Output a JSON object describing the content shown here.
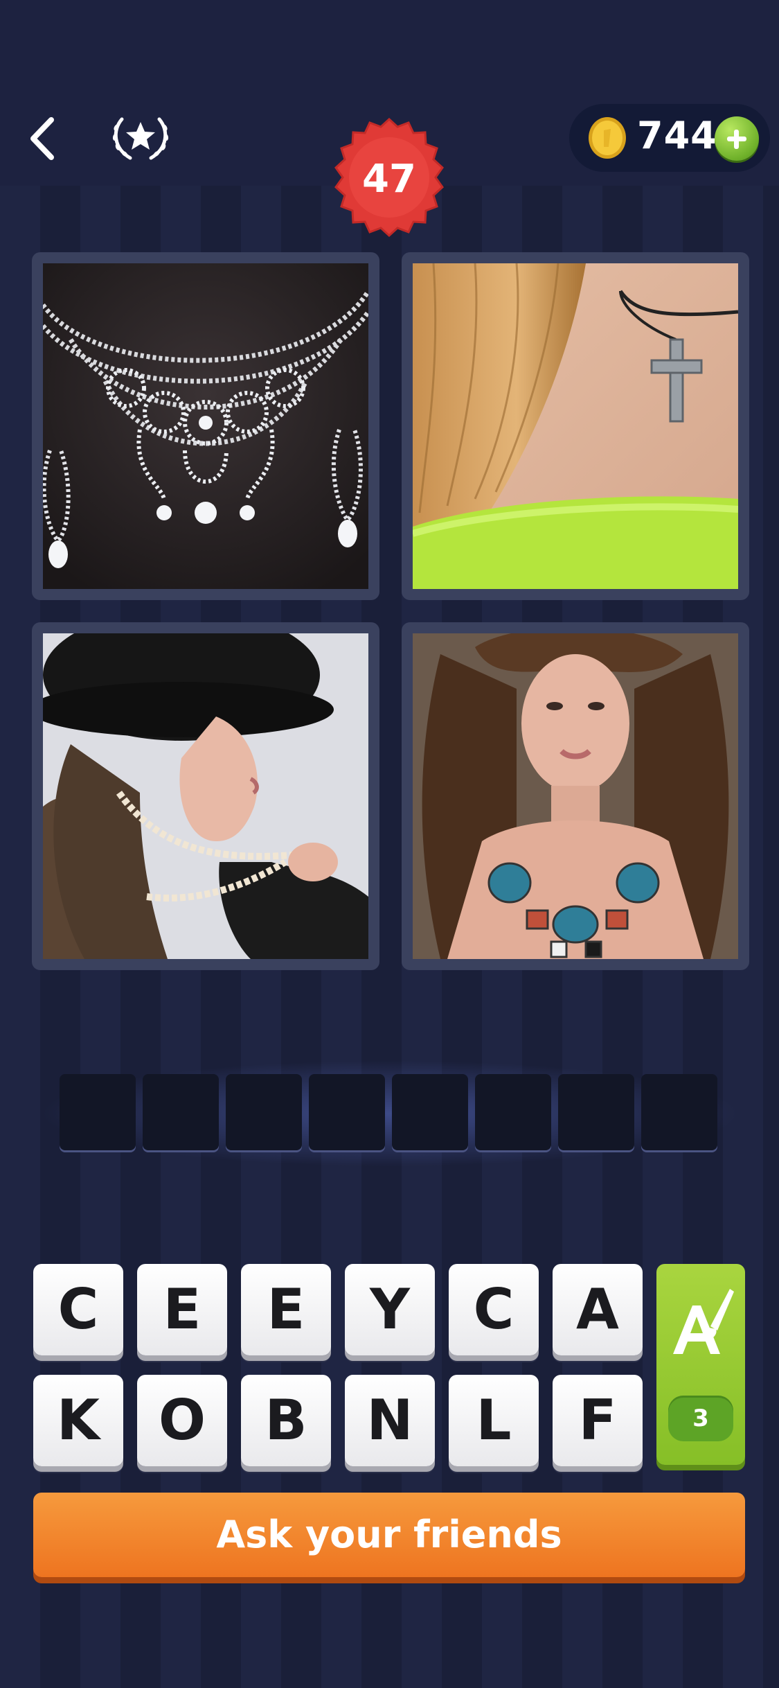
{
  "header": {
    "back_icon": "chevron-left-icon",
    "achievements_icon": "laurel-star-icon",
    "coins": "744",
    "coin_icon": "gold-coin-icon",
    "add_coins_icon": "plus-icon",
    "level": "47",
    "level_badge_color": "#e03a36"
  },
  "puzzle": {
    "images": [
      {
        "name": "diamond-necklace-and-earrings",
        "subject": "rhinestone necklace with drop earrings"
      },
      {
        "name": "cross-pendant-on-neck",
        "subject": "cross pendant on a cord"
      },
      {
        "name": "woman-in-fur-hat-with-pearls",
        "subject": "woman holding a pearl necklace"
      },
      {
        "name": "woman-with-stone-necklace",
        "subject": "woman wearing a chunky stone necklace"
      }
    ],
    "answer_length": 8,
    "answer_slots": [
      "",
      "",
      "",
      "",
      "",
      "",
      "",
      ""
    ]
  },
  "keyboard": {
    "row1": [
      "C",
      "E",
      "E",
      "Y",
      "C",
      "A"
    ],
    "row2": [
      "K",
      "O",
      "B",
      "N",
      "L",
      "F"
    ]
  },
  "hint": {
    "icon": "letter-brush-icon",
    "count": "3",
    "color": "#92c52f"
  },
  "ask_button": {
    "label": "Ask your friends",
    "color": "#f08428"
  }
}
